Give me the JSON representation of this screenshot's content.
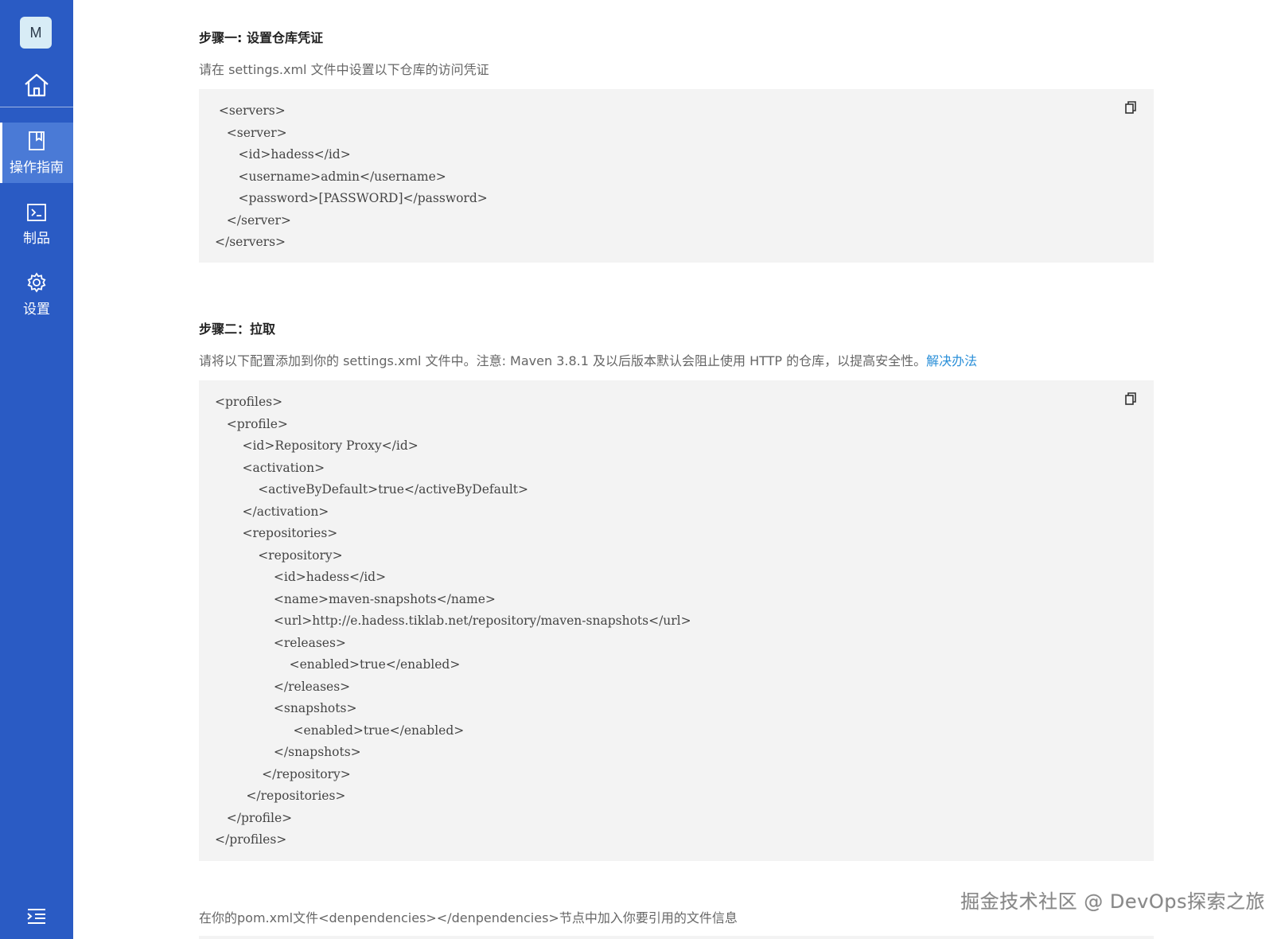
{
  "sidebar": {
    "avatar_letter": "M",
    "home_icon": "home-icon",
    "items": [
      {
        "label": "操作指南",
        "icon": "book-icon",
        "active": true
      },
      {
        "label": "制品",
        "icon": "terminal-icon",
        "active": false
      },
      {
        "label": "设置",
        "icon": "gear-icon",
        "active": false
      }
    ],
    "collapse_icon": "menu-collapse-icon"
  },
  "step1": {
    "title": "步骤一: 设置仓库凭证",
    "description": "请在 settings.xml 文件中设置以下仓库的访问凭证",
    "code": " <servers>\n   <server>\n      <id>hadess</id>\n      <username>admin</username>\n      <password>[PASSWORD]</password>\n   </server>\n</servers>"
  },
  "step2": {
    "title": "步骤二：拉取",
    "description": "请将以下配置添加到你的 settings.xml 文件中。注意: Maven 3.8.1 及以后版本默认会阻止使用 HTTP 的仓库，以提高安全性。",
    "link": "解决办法",
    "code": "<profiles>\n   <profile>\n       <id>Repository Proxy</id>\n       <activation>\n           <activeByDefault>true</activeByDefault>\n       </activation>\n       <repositories>\n           <repository>\n               <id>hadess</id>\n               <name>maven-snapshots</name>\n               <url>http://e.hadess.tiklab.net/repository/maven-snapshots</url>\n               <releases>\n                   <enabled>true</enabled>\n               </releases>\n               <snapshots>\n                    <enabled>true</enabled>\n               </snapshots>\n            </repository>\n        </repositories>\n   </profile>\n</profiles>"
  },
  "step3": {
    "description": "在你的pom.xml文件<denpendencies></denpendencies>节点中加入你要引用的文件信息"
  },
  "watermark": "掘金技术社区 @ DevOps探索之旅",
  "colors": {
    "sidebar": "#2a5bc4",
    "sidebar_active": "#4a7ad6",
    "code_bg": "#f3f3f3",
    "link": "#2a8fd8"
  }
}
